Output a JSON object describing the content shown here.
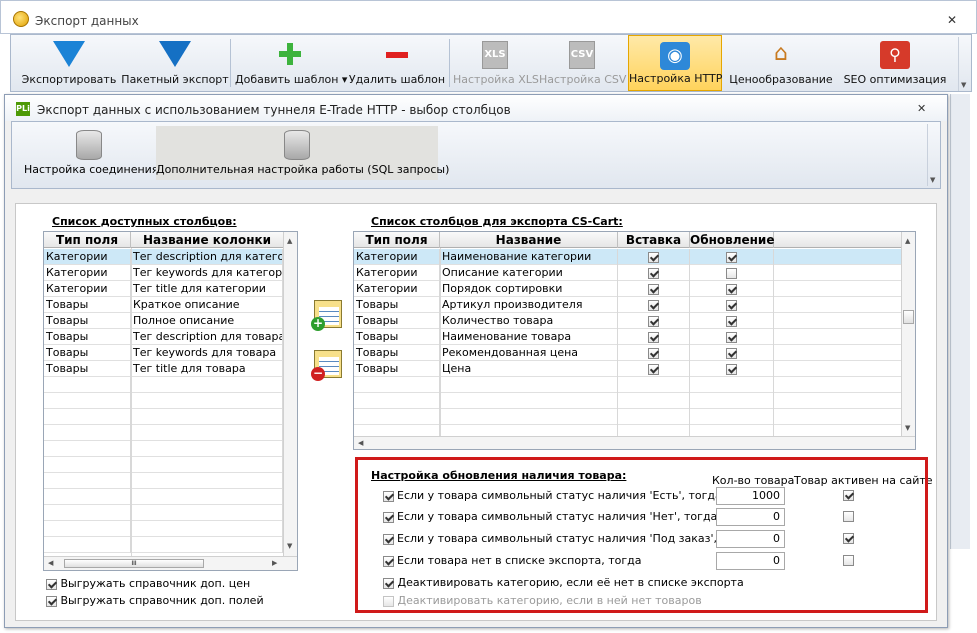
{
  "window": {
    "title": "Экспорт данных"
  },
  "toolbar": {
    "buttons": [
      {
        "label": "Экспортировать",
        "icon": "export-arrow-icon",
        "enabled": true
      },
      {
        "label": "Пакетный экспорт",
        "icon": "batch-export-icon",
        "enabled": true
      },
      {
        "label": "Добавить шаблон",
        "icon": "plus-icon",
        "enabled": true,
        "dropdown": true
      },
      {
        "label": "Удалить шаблон",
        "icon": "minus-icon",
        "enabled": true
      },
      {
        "label": "Настройка XLS",
        "icon": "xls-file-icon",
        "enabled": false
      },
      {
        "label": "Настройка CSV",
        "icon": "csv-file-icon",
        "enabled": false
      },
      {
        "label": "Настройка HTTP",
        "icon": "http-globe-icon",
        "enabled": true,
        "active": true
      },
      {
        "label": "Ценообразование",
        "icon": "pricing-house-icon",
        "enabled": true
      },
      {
        "label": "SEO оптимизация",
        "icon": "seo-magnifier-icon",
        "enabled": true
      }
    ]
  },
  "dialog": {
    "title": "Экспорт данных с использованием туннеля E-Trade HTTP - выбор столбцов",
    "icon_text": "PLi",
    "ribbon": {
      "connection_label": "Настройка соединения",
      "sql_label": "Дополнительная настройка работы (SQL запросы)"
    },
    "available": {
      "title": "Список доступных столбцов:",
      "headers": [
        "Тип поля",
        "Название колонки"
      ],
      "rows": [
        [
          "Категории",
          "Тег description для категории"
        ],
        [
          "Категории",
          "Тег keywords для категории"
        ],
        [
          "Категории",
          "Тег title для категории"
        ],
        [
          "Товары",
          "Краткое описание"
        ],
        [
          "Товары",
          "Полное описание"
        ],
        [
          "Товары",
          "Тег description для товара"
        ],
        [
          "Товары",
          "Тег keywords для товара"
        ],
        [
          "Товары",
          "Тег title для товара"
        ]
      ],
      "hscroll_grip": "III"
    },
    "export": {
      "title": "Список столбцов для экспорта CS-Cart:",
      "headers": [
        "Тип поля",
        "Название",
        "Вставка",
        "Обновление"
      ],
      "rows": [
        {
          "type": "Категории",
          "name": "Наименование категории",
          "insert": true,
          "update": true
        },
        {
          "type": "Категории",
          "name": "Описание категории",
          "insert": true,
          "update": false
        },
        {
          "type": "Категории",
          "name": "Порядок сортировки",
          "insert": true,
          "update": true
        },
        {
          "type": "Товары",
          "name": "Артикул производителя",
          "insert": true,
          "update": true
        },
        {
          "type": "Товары",
          "name": "Количество товара",
          "insert": true,
          "update": true
        },
        {
          "type": "Товары",
          "name": "Наименование товара",
          "insert": true,
          "update": true
        },
        {
          "type": "Товары",
          "name": "Рекомендованная цена",
          "insert": true,
          "update": true
        },
        {
          "type": "Товары",
          "name": "Цена",
          "insert": true,
          "update": true
        }
      ]
    },
    "checkboxes_bottom": [
      {
        "label": "Выгружать справочник доп. цен",
        "checked": true
      },
      {
        "label": "Выгружать справочник доп. полей",
        "checked": true
      }
    ],
    "availability": {
      "title": "Настройка обновления наличия товара:",
      "col_qty": "Кол-во товара",
      "col_active": "Товар активен на сайте",
      "rows": [
        {
          "label": "Если у товара символьный статус наличия 'Есть', тогда",
          "checked": true,
          "qty": "1000",
          "active": true
        },
        {
          "label": "Если у товара символьный статус наличия 'Нет', тогда",
          "checked": true,
          "qty": "0",
          "active": false
        },
        {
          "label": "Если у товара символьный статус наличия 'Под заказ', тогда",
          "checked": true,
          "qty": "0",
          "active": true
        },
        {
          "label": "Если товара нет в списке экспорта, тогда",
          "checked": true,
          "qty": "0",
          "active": false
        }
      ],
      "deactivate_missing": {
        "label": "Деактивировать категорию, если её нет в списке экспорта",
        "checked": true
      },
      "deactivate_empty": {
        "label": "Деактивировать категорию, если в ней нет товаров",
        "checked": false,
        "enabled": false
      }
    }
  },
  "colors": {
    "highlight": "#d01a1a",
    "selection": "#cde8f7",
    "active_button": "#ffd35c"
  }
}
